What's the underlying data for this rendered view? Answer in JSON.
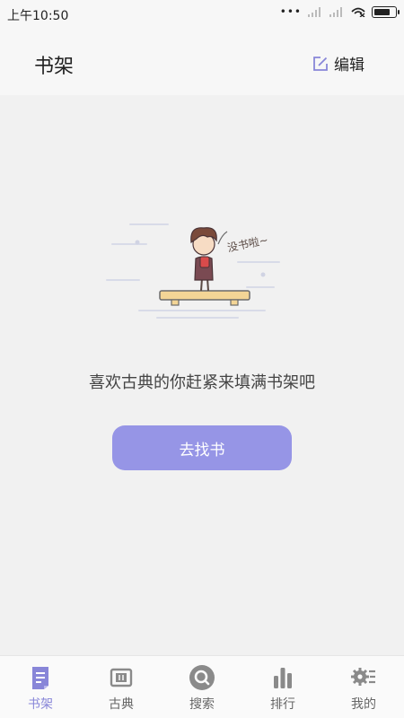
{
  "status_bar": {
    "time": "上午10:50",
    "dots": "•••"
  },
  "header": {
    "title": "书架",
    "edit_label": "编辑"
  },
  "main": {
    "speech_bubble": "没书啦~",
    "empty_message": "喜欢古典的你赶紧来填满书架吧",
    "find_button_label": "去找书"
  },
  "nav": {
    "items": [
      {
        "label": "书架",
        "icon": "bookshelf-icon",
        "active": true
      },
      {
        "label": "古典",
        "icon": "scroll-icon",
        "active": false
      },
      {
        "label": "搜索",
        "icon": "search-icon",
        "active": false
      },
      {
        "label": "排行",
        "icon": "ranking-icon",
        "active": false
      },
      {
        "label": "我的",
        "icon": "settings-icon",
        "active": false
      }
    ]
  },
  "colors": {
    "accent": "#9695e6",
    "active_nav": "#8886d8",
    "inactive_icon": "#8a8a8a"
  }
}
